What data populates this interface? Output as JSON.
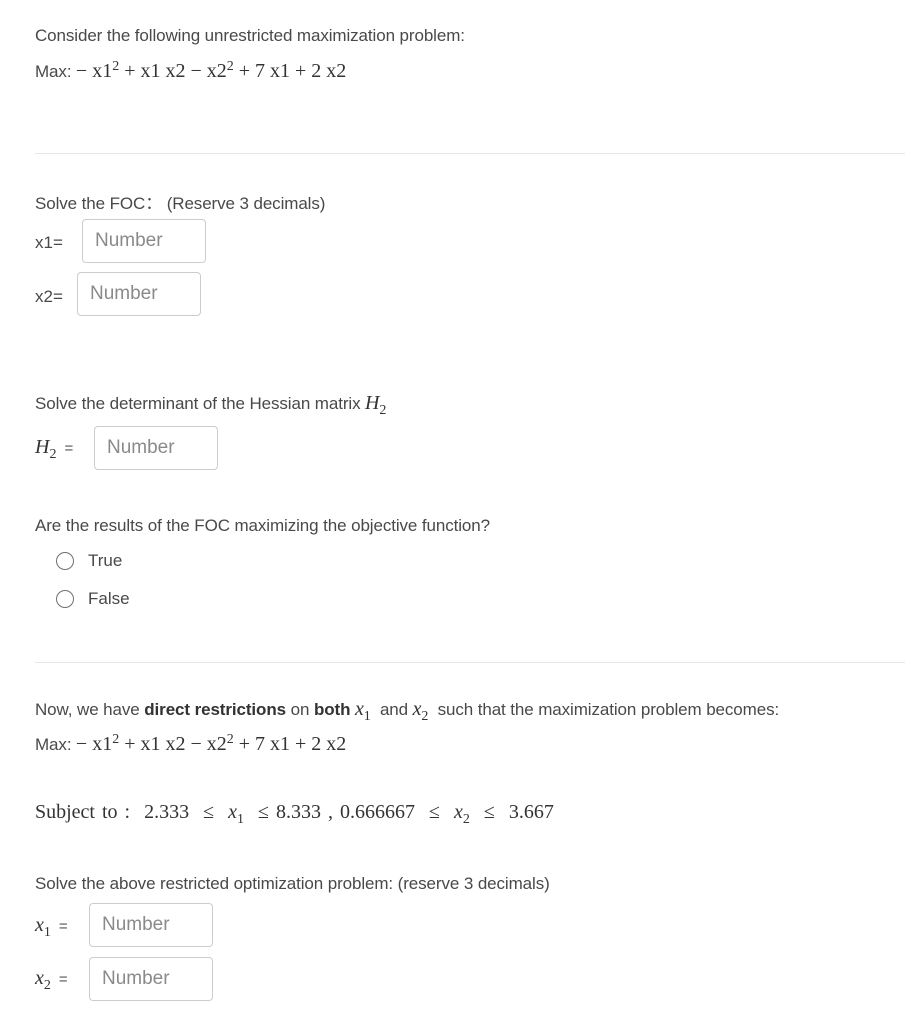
{
  "intro": {
    "text": "Consider the following unrestricted maximization problem:",
    "objective_prefix": "Max:",
    "objective": {
      "t1_sign": "−",
      "t1": "x1",
      "t1_exp": "2",
      "t2": "+ x1 x2",
      "t3_sign": "−",
      "t3": "x2",
      "t3_exp": "2",
      "t4": "+ 7 x1 + 2 x2"
    }
  },
  "foc": {
    "prompt": "Solve the FOC：  (Reserve 3 decimals)",
    "x1_label": "x1=",
    "x2_label": "x2=",
    "x1_placeholder": "Number",
    "x2_placeholder": "Number"
  },
  "hessian": {
    "prompt": "Solve the determinant of the Hessian matrix",
    "symbol": "H",
    "symbol_sub": "2",
    "eq": "=",
    "placeholder": "Number"
  },
  "question": {
    "prompt": "Are the results of the FOC maximizing the objective function?",
    "options": [
      {
        "label": "True",
        "selected": false
      },
      {
        "label": "False",
        "selected": false
      }
    ]
  },
  "restricted": {
    "intro_1": "Now, we have ",
    "intro_bold_1": "direct restrictions",
    "intro_2": " on ",
    "intro_bold_2": "both",
    "var_x": "x",
    "sub_1": "1",
    "sub_2": "2",
    "intro_and": "and",
    "intro_3": "such that  the maximization problem becomes:",
    "objective_prefix": "Max:",
    "constraint": {
      "label": "Subject to :",
      "x1_low": "2.333",
      "x1_high": "8.333",
      "x2_low": "0.666667",
      "x2_high": "3.667",
      "leq": "≤",
      "comma": ","
    },
    "solve_prompt": "Solve the above restricted optimization problem: (reserve 3 decimals)",
    "eq": "=",
    "x1_placeholder": "Number",
    "x2_placeholder": "Number"
  }
}
